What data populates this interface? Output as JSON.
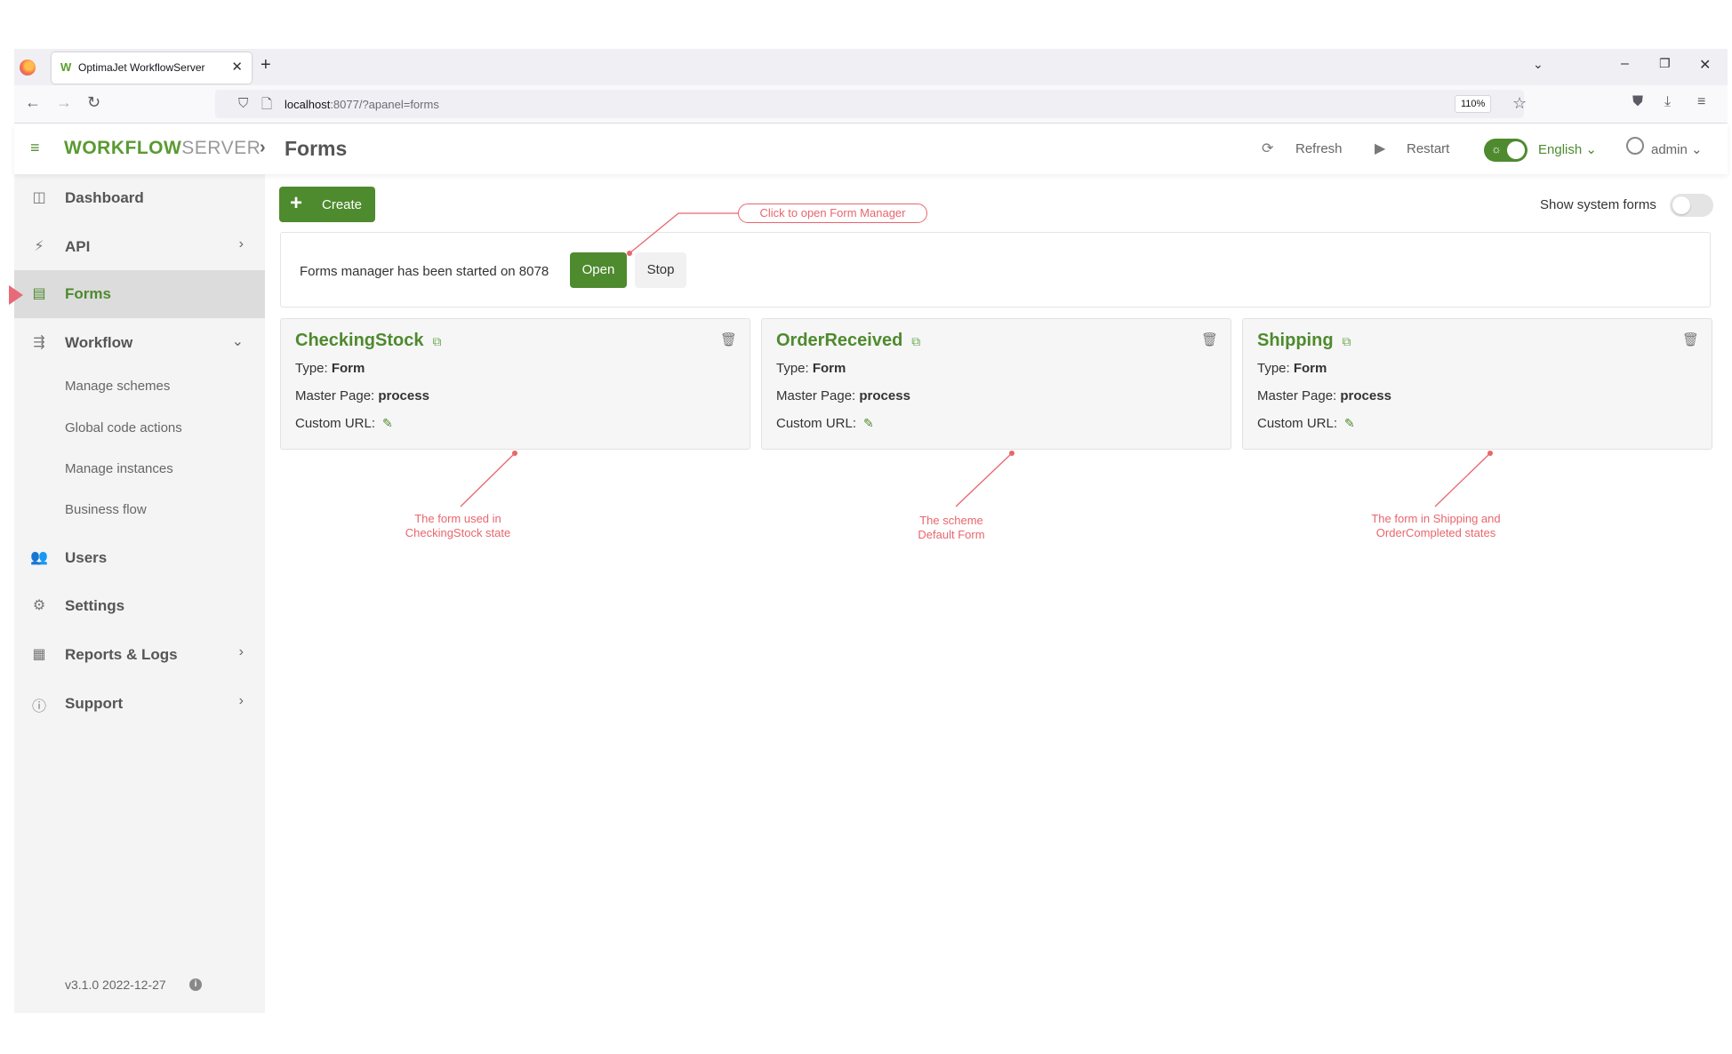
{
  "browser": {
    "tab_title": "OptimaJet WorkflowServer",
    "url_host": "localhost",
    "url_rest": ":8077/?apanel=forms",
    "zoom": "110%"
  },
  "header": {
    "brand_part1": "WORKFLOW",
    "brand_part2": "SERVER",
    "page_title": "Forms",
    "refresh_label": "Refresh",
    "restart_label": "Restart",
    "language": "English",
    "user": "admin"
  },
  "sidebar": {
    "items": [
      {
        "label": "Dashboard"
      },
      {
        "label": "API"
      },
      {
        "label": "Forms"
      },
      {
        "label": "Workflow"
      },
      {
        "label": "Users"
      },
      {
        "label": "Settings"
      },
      {
        "label": "Reports & Logs"
      },
      {
        "label": "Support"
      }
    ],
    "workflow_sub": [
      "Manage schemes",
      "Global code actions",
      "Manage instances",
      "Business flow"
    ],
    "version": "v3.1.0 2022-12-27"
  },
  "main": {
    "create_label": "Create",
    "show_system_forms_label": "Show system forms",
    "manager_text": "Forms manager has been started on 8078",
    "open_label": "Open",
    "stop_label": "Stop",
    "cards": [
      {
        "title": "CheckingStock",
        "type_label": "Type:",
        "type": "Form",
        "master_label": "Master Page:",
        "master": "process",
        "url_label": "Custom URL:"
      },
      {
        "title": "OrderReceived",
        "type_label": "Type:",
        "type": "Form",
        "master_label": "Master Page:",
        "master": "process",
        "url_label": "Custom URL:"
      },
      {
        "title": "Shipping",
        "type_label": "Type:",
        "type": "Form",
        "master_label": "Master Page:",
        "master": "process",
        "url_label": "Custom URL:"
      }
    ]
  },
  "annotations": {
    "callout": "Click to open Form Manager",
    "note1_line1": "The form used in",
    "note1_line2": "CheckingStock state",
    "note2_line1": "The scheme",
    "note2_line2": "Default Form",
    "note3_line1": "The form in Shipping and",
    "note3_line2": "OrderCompleted states"
  },
  "colors": {
    "accent": "#4e8a2e",
    "annotation": "#e8666d"
  }
}
